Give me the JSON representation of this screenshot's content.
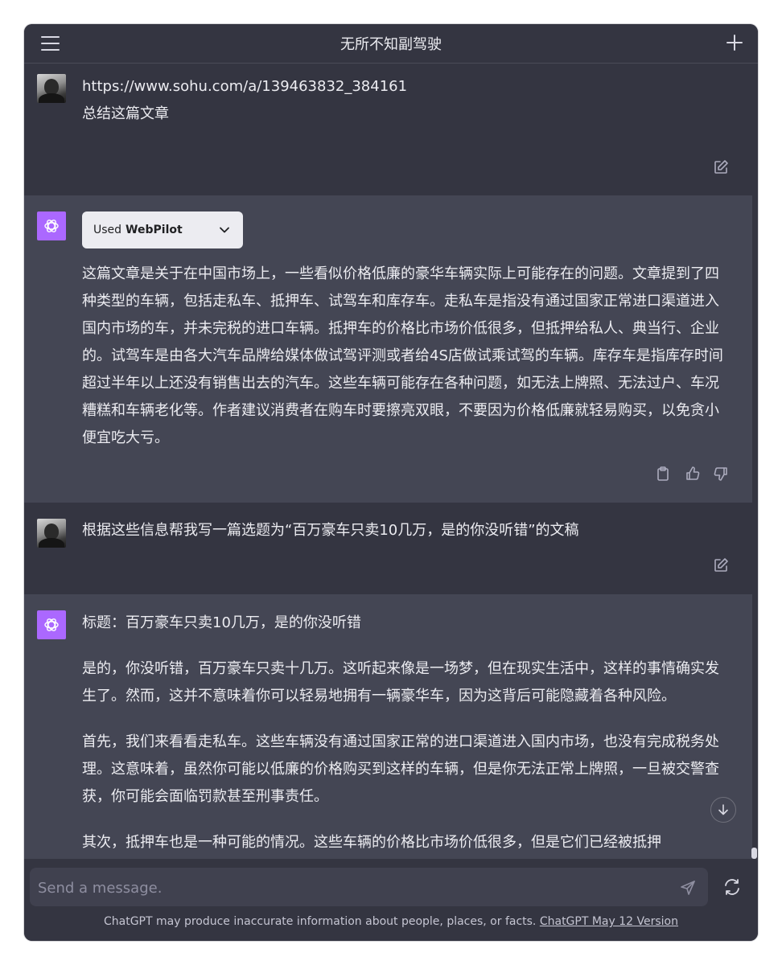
{
  "header": {
    "title": "无所不知副驾驶"
  },
  "conversation": {
    "m1": {
      "url": "https://www.sohu.com/a/139463832_384161",
      "text": "总结这篇文章"
    },
    "m2": {
      "plugin_used_prefix": "Used",
      "plugin_name": "WebPilot",
      "text": "这篇文章是关于在中国市场上，一些看似价格低廉的豪华车辆实际上可能存在的问题。文章提到了四种类型的车辆，包括走私车、抵押车、试驾车和库存车。走私车是指没有通过国家正常进口渠道进入国内市场的车，并未完税的进口车辆。抵押车的价格比市场价低很多，但抵押给私人、典当行、企业的。试驾车是由各大汽车品牌给媒体做试驾评测或者给4S店做试乘试驾的车辆。库存车是指库存时间超过半年以上还没有销售出去的汽车。这些车辆可能存在各种问题，如无法上牌照、无法过户、车况糟糕和车辆老化等。作者建议消费者在购车时要擦亮双眼，不要因为价格低廉就轻易购买，以免贪小便宜吃大亏。"
    },
    "m3": {
      "text": "根据这些信息帮我写一篇选题为“百万豪车只卖10几万，是的你没听错”的文稿"
    },
    "m4": {
      "title": "标题：百万豪车只卖10几万，是的你没听错",
      "p1": "是的，你没听错，百万豪车只卖十几万。这听起来像是一场梦，但在现实生活中，这样的事情确实发生了。然而，这并不意味着你可以轻易地拥有一辆豪华车，因为这背后可能隐藏着各种风险。",
      "p2": "首先，我们来看看走私车。这些车辆没有通过国家正常的进口渠道进入国内市场，也没有完成税务处理。这意味着，虽然你可能以低廉的价格购买到这样的车辆，但是你无法正常上牌照，一旦被交警查获，你可能会面临罚款甚至刑事责任。",
      "p3": "其次，抵押车也是一种可能的情况。这些车辆的价格比市场价低很多，但是它们已经被抵押"
    }
  },
  "composer": {
    "placeholder": "Send a message."
  },
  "footer": {
    "disclaimer": "ChatGPT may produce inaccurate information about people, places, or facts.",
    "version_link": "ChatGPT May 12 Version"
  },
  "colors": {
    "background": "#343541",
    "assistant_bg": "#444654",
    "text": "#ececf1",
    "bot_avatar": "#ab68ff",
    "input_bg": "#40414f"
  },
  "icons": {
    "menu": "hamburger-icon",
    "new_chat": "plus-icon",
    "edit": "edit-icon",
    "copy": "clipboard-icon",
    "like": "thumbs-up-icon",
    "dislike": "thumbs-down-icon",
    "send": "send-icon",
    "regenerate": "refresh-icon",
    "scroll": "arrow-down-icon",
    "bot_avatar": "openai-logo-icon"
  }
}
